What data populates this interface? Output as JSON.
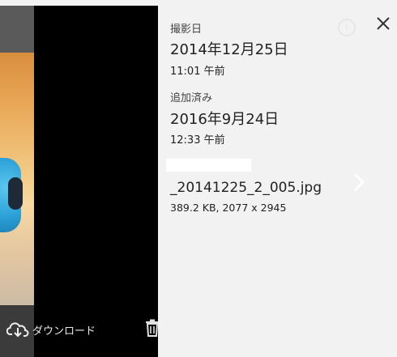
{
  "toolbar": {
    "download_label": "ダウンロード",
    "delete_label": "削除"
  },
  "details": {
    "taken_label": "撮影日",
    "taken_date": "2014年12月25日",
    "taken_time": "11:01 午前",
    "added_label": "追加済み",
    "added_date": "2016年9月24日",
    "added_time": "12:33 午前",
    "filename": "_20141225_2_005.jpg",
    "file_meta": "389.2 KB, 2077 x 2945"
  },
  "colors": {
    "panel_bg": "#f2f2f2",
    "viewer_bg": "#000000",
    "text": "#222222"
  },
  "icons": [
    "close-icon",
    "info-icon",
    "cloud-download-icon",
    "trash-icon",
    "chevron-right-icon"
  ]
}
